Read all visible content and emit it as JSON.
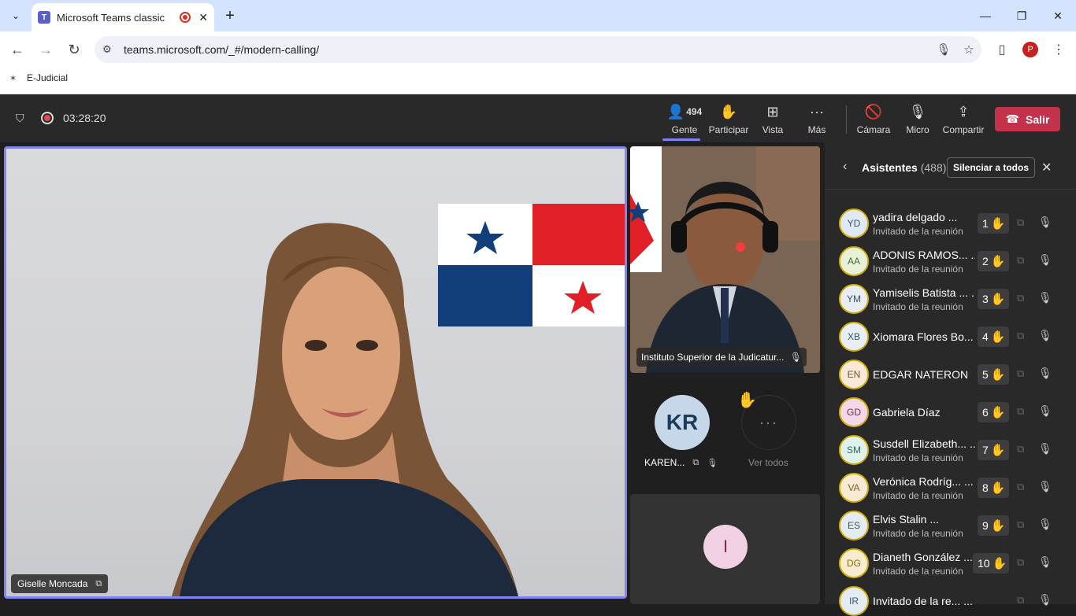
{
  "browser": {
    "tab_title": "Microsoft Teams classic",
    "url": "teams.microsoft.com/_#/modern-calling/",
    "bookmark": "E-Judicial",
    "profile_initial": "P"
  },
  "meeting": {
    "timer": "03:28:20",
    "people_count": "494",
    "controls": {
      "people": "Gente",
      "raise": "Participar",
      "view": "Vista",
      "more": "Más",
      "camera": "Cámara",
      "mic": "Micro",
      "share": "Compartir",
      "leave": "Salir"
    }
  },
  "stage": {
    "main_name": "Giselle Moncada",
    "thumb1_name": "Instituto Superior de la Judicatur...",
    "kr_initials": "KR",
    "kr_name": "KAREN...",
    "see_all": "Ver todos",
    "i_initial": "I"
  },
  "panel": {
    "title": "Asistentes",
    "count": "(488)",
    "mute_all": "Silenciar a todos",
    "attendees": [
      {
        "initials": "YD",
        "name": "yadira delgado ...",
        "sub": "Invitado de la reunión",
        "num": "1"
      },
      {
        "initials": "AA",
        "name": "ADONIS RAMOS... ...",
        "sub": "Invitado de la reunión",
        "num": "2"
      },
      {
        "initials": "YM",
        "name": "Yamiselis Batista ... ...",
        "sub": "Invitado de la reunión",
        "num": "3"
      },
      {
        "initials": "XB",
        "name": "Xiomara Flores Bo...",
        "sub": "",
        "num": "4"
      },
      {
        "initials": "EN",
        "name": "EDGAR NATERON",
        "sub": "",
        "num": "5"
      },
      {
        "initials": "GD",
        "name": "Gabriela Díaz",
        "sub": "",
        "num": "6"
      },
      {
        "initials": "SM",
        "name": "Susdell Elizabeth... ...",
        "sub": "Invitado de la reunión",
        "num": "7"
      },
      {
        "initials": "VA",
        "name": "Verónica Rodríg... ...",
        "sub": "Invitado de la reunión",
        "num": "8"
      },
      {
        "initials": "ES",
        "name": "Elvis Stalin ...",
        "sub": "Invitado de la reunión",
        "num": "9"
      },
      {
        "initials": "DG",
        "name": "Dianeth González ...",
        "sub": "Invitado de la reunión",
        "num": "10"
      },
      {
        "initials": "IR",
        "name": "Invitado de la re... ...",
        "sub": "",
        "num": ""
      }
    ]
  }
}
